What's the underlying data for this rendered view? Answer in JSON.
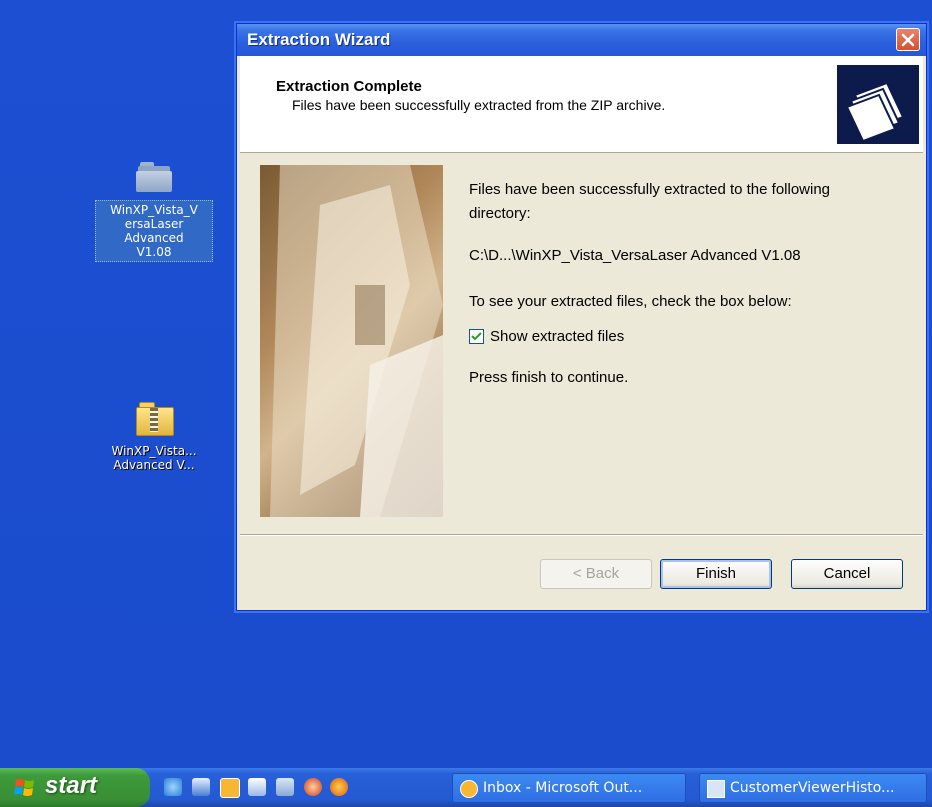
{
  "desktop": {
    "icons": [
      {
        "label_lines": [
          "WinXP_Vista_V",
          "ersaLaser",
          "Advanced",
          "V1.08"
        ],
        "icon": "folder-icon",
        "selected": true
      },
      {
        "label_lines": [
          "WinXP_Vista...",
          "Advanced V..."
        ],
        "icon": "zip-folder-icon",
        "selected": false
      }
    ]
  },
  "wizard": {
    "title": "Extraction Wizard",
    "header_title": "Extraction Complete",
    "header_subtitle": "Files have been successfully extracted from the ZIP archive.",
    "message1": "Files have been successfully extracted to the following directory:",
    "path": "C:\\D...\\WinXP_Vista_VersaLaser Advanced V1.08",
    "message2": "To see your extracted files, check the box below:",
    "checkbox_label": "Show extracted files",
    "checkbox_checked": true,
    "message3": "Press finish to continue.",
    "buttons": {
      "back": "< Back",
      "finish": "Finish",
      "cancel": "Cancel"
    }
  },
  "taskbar": {
    "start_label": "start",
    "quicklaunch": [
      "ie-icon",
      "windows-media-icon",
      "clock-icon",
      "sync-icon",
      "notepad-icon",
      "media-icon",
      "firefox-icon"
    ],
    "tasks": [
      {
        "label": "Inbox - Microsoft Out...",
        "icon": "outlook-icon"
      },
      {
        "label": "CustomerViewerHisto...",
        "icon": "window-icon"
      }
    ]
  },
  "colors": {
    "desktop_bg": "#1b4fd0",
    "titlebar": "#2a5fdd",
    "window_bg": "#ece9d8",
    "start_green": "#3d9a3a"
  }
}
